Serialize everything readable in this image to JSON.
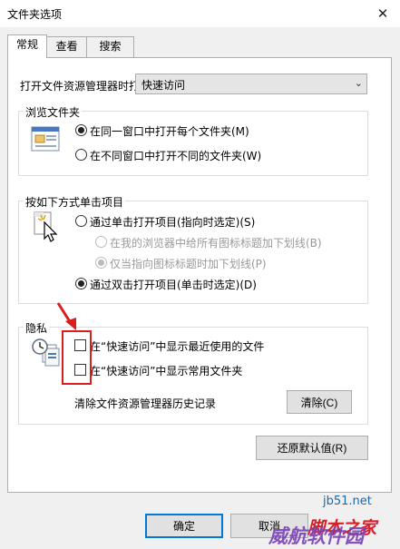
{
  "window": {
    "title": "文件夹选项",
    "close_glyph": "✕"
  },
  "tabs": [
    {
      "label": "常规",
      "active": true
    },
    {
      "label": "查看",
      "active": false
    },
    {
      "label": "搜索",
      "active": false
    }
  ],
  "open_explorer": {
    "label": "打开文件资源管理器时打",
    "selected": "快速访问",
    "arrow_glyph": "⌄"
  },
  "browse": {
    "title": "浏览文件夹",
    "options": [
      {
        "label": "在同一窗口中打开每个文件夹(M)",
        "checked": true
      },
      {
        "label": "在不同窗口中打开不同的文件夹(W)",
        "checked": false
      }
    ]
  },
  "click": {
    "title": "按如下方式单击项目",
    "single": "通过单击打开项目(指向时选定)(S)",
    "underline_all": "在我的浏览器中给所有图标标题加下划线(B)",
    "underline_point": "仅当指向图标标题时加下划线(P)",
    "double": "通过双击打开项目(单击时选定)(D)"
  },
  "privacy": {
    "title": "隐私",
    "recent": "在“快速访问”中显示最近使用的文件",
    "frequent": "在“快速访问”中显示常用文件夹",
    "clear_label": "清除文件资源管理器历史记录",
    "clear_button": "清除(C)"
  },
  "restore_button": "还原默认值(R)",
  "footer": {
    "ok": "确定",
    "cancel": "取消"
  },
  "watermark": {
    "site": "jb51.net",
    "brand": "脚本之家",
    "overlay": "威航软件园"
  },
  "colors": {
    "annotation_red": "#d81e1e",
    "accent_blue": "#0078d7"
  }
}
